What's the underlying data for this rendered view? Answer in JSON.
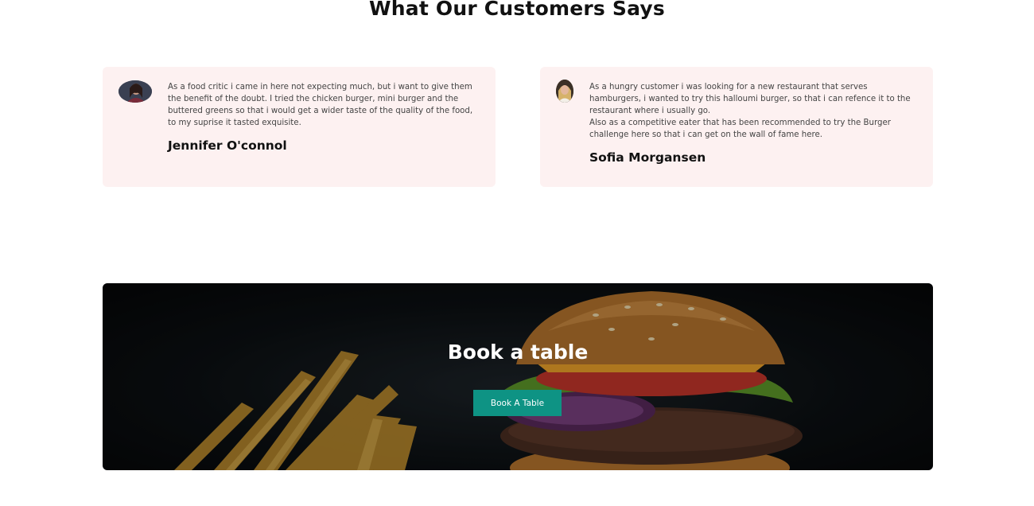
{
  "testimonials": {
    "title": "What Our Customers Says",
    "cards": [
      {
        "quote": "As a food critic i came in here not expecting much, but i want to give them the benefit of the doubt. I tried the chicken burger, mini burger and the buttered greens so that i would get a wider taste of the quality of the food, to my suprise it tasted exquisite.",
        "author": "Jennifer O'connol",
        "avatar_icon": "woman-portrait-avatar"
      },
      {
        "quote": "As a hungry customer i was looking for a new restaurant that serves hamburgers, i wanted to try this halloumi burger, so that i can refence it to the restaurant where i usually go.\nAlso as a competitive eater that has been recommended to try the Burger challenge here so that i can get on the wall of fame here.",
        "author": "Sofia Morgansen",
        "avatar_icon": "woman-portrait-avatar"
      }
    ]
  },
  "booking": {
    "title": "Book a table",
    "button_label": "Book A Table",
    "button_color": "#0e9384",
    "background_image": "burger-and-fries-photo"
  },
  "colors": {
    "card_background": "#fdf1f1",
    "banner_background": "#0c1013"
  }
}
